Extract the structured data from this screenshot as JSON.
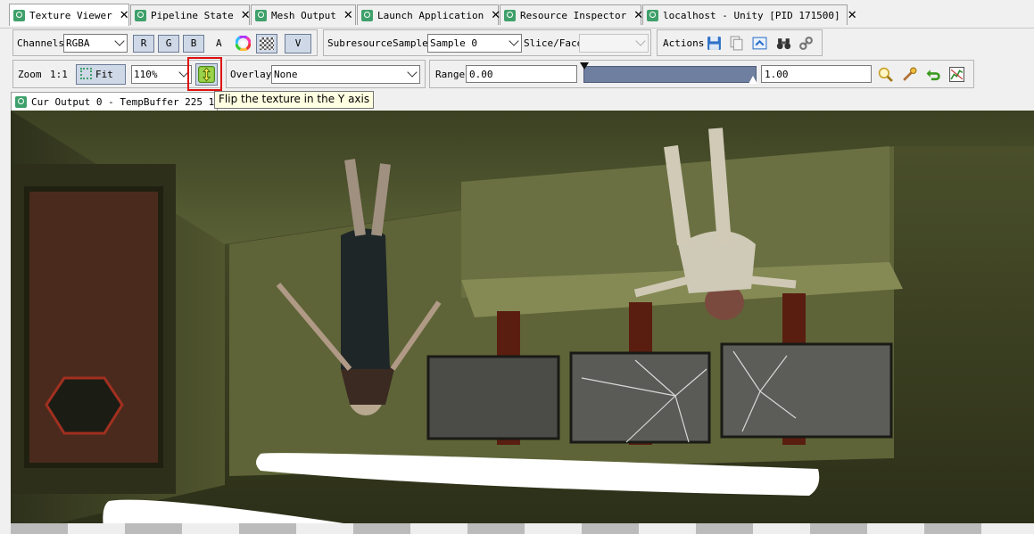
{
  "tabs": [
    {
      "label": "Texture Viewer",
      "active": true
    },
    {
      "label": "Pipeline State",
      "active": false
    },
    {
      "label": "Mesh Output",
      "active": false
    },
    {
      "label": "Launch Application",
      "active": false
    },
    {
      "label": "Resource Inspector",
      "active": false
    },
    {
      "label": "localhost - Unity [PID 171500]",
      "active": false
    }
  ],
  "toolbar1": {
    "channels_label": "Channels",
    "channels_value": "RGBA",
    "r": "R",
    "g": "G",
    "b": "B",
    "a": "A",
    "v": "V",
    "subresource_label": "Subresource",
    "sample_label": "Sample",
    "sample_value": "Sample 0",
    "slice_label": "Slice/Face",
    "actions_label": "Actions"
  },
  "toolbar2": {
    "zoom_label": "Zoom",
    "one_to_one": "1:1",
    "fit_label": "Fit",
    "zoom_value": "110%",
    "overlay_label": "Overlay",
    "overlay_value": "None",
    "range_label": "Range",
    "range_min": "0.00",
    "range_max": "1.00"
  },
  "output_tab": {
    "label": "Cur Output 0 - TempBuffer 225 1039"
  },
  "tooltip": "Flip the texture in the Y axis",
  "colors": {
    "tab_icon": "#3ea06a",
    "highlight": "#e01010",
    "range_bar": "#6e7fa0",
    "tooltip_bg": "#ffffe1"
  }
}
